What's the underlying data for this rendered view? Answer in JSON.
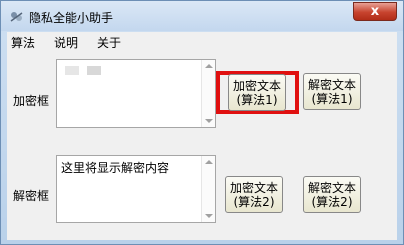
{
  "window": {
    "title": "隐私全能小助手",
    "close_label": "x"
  },
  "menu": [
    "算法",
    "说明",
    "关于"
  ],
  "encrypt_box": {
    "label": "加密框",
    "content": ""
  },
  "decrypt_box": {
    "label": "解密框",
    "content": "这里将显示解密内容"
  },
  "buttons": {
    "encrypt1": {
      "line1": "加密文本",
      "line2": "(算法1)"
    },
    "decrypt1": {
      "line1": "解密文本",
      "line2": "(算法1)"
    },
    "encrypt2": {
      "line1": "加密文本",
      "line2": "(算法2)"
    },
    "decrypt2": {
      "line1": "解密文本",
      "line2": "(算法2)"
    }
  },
  "highlight_color": "#e01010"
}
